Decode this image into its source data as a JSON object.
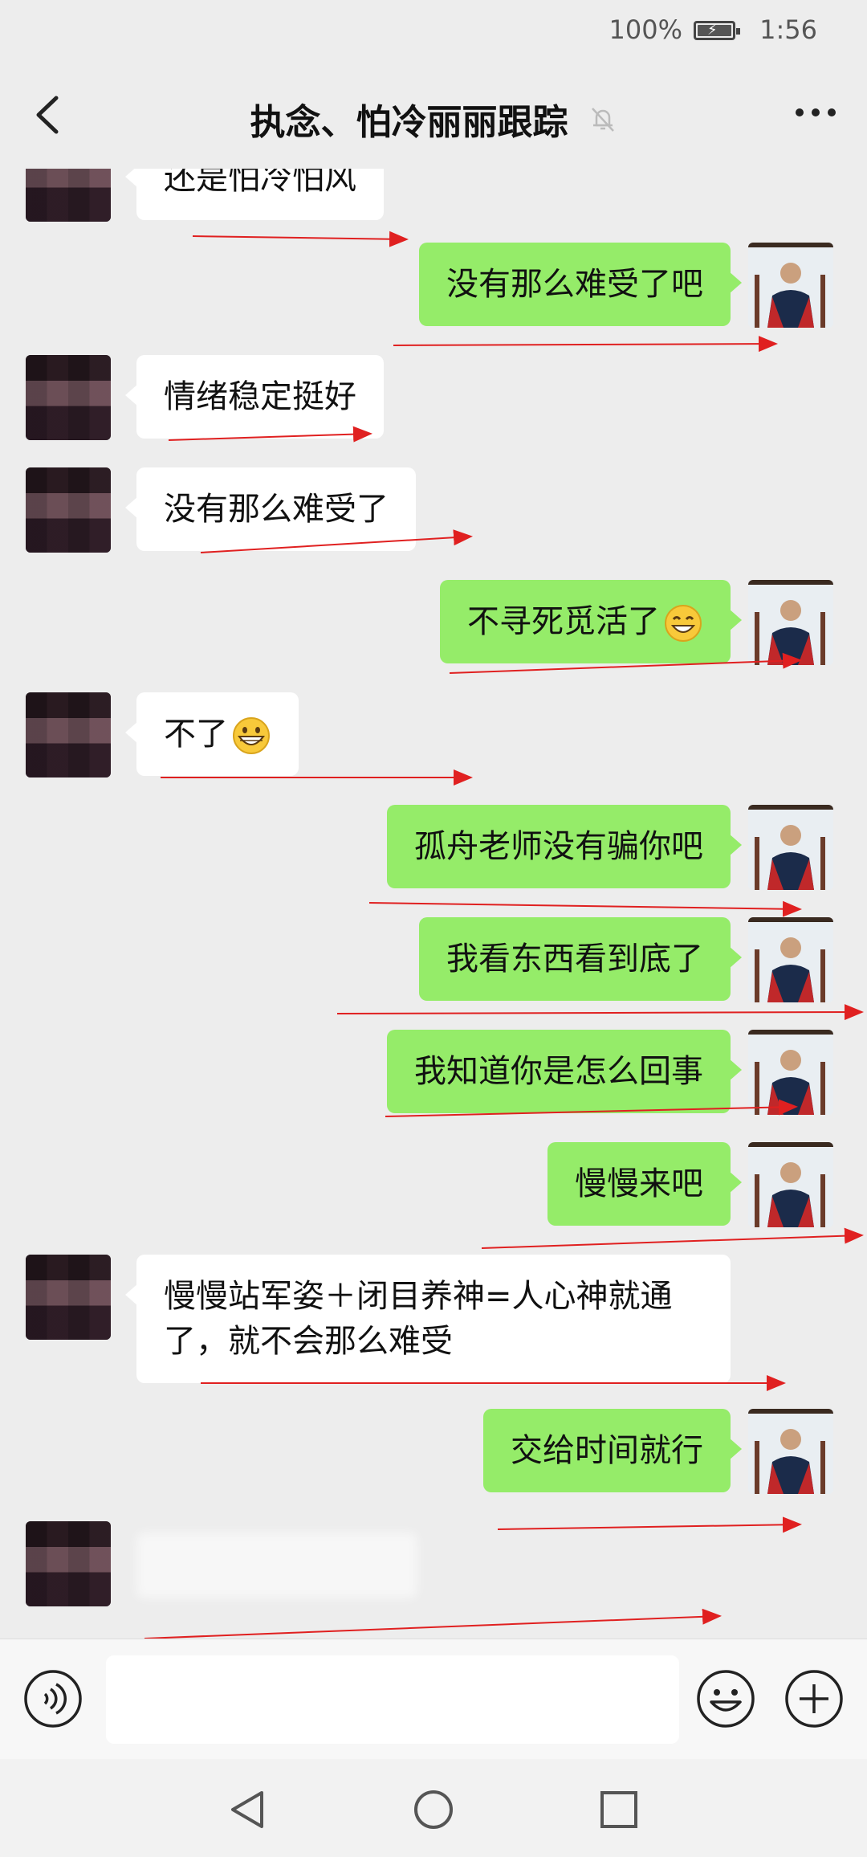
{
  "status_bar": {
    "battery_percent": "100%",
    "time": "1:56"
  },
  "header": {
    "title": "执念、怕冷丽丽跟踪"
  },
  "messages": [
    {
      "side": "left",
      "text": "还是怕冷怕风"
    },
    {
      "side": "right",
      "text": "没有那么难受了吧"
    },
    {
      "side": "left",
      "text": "情绪稳定挺好"
    },
    {
      "side": "left",
      "text": "没有那么难受了"
    },
    {
      "side": "right",
      "text": "不寻死觅活了",
      "emoji": "grin-emoji"
    },
    {
      "side": "left",
      "text": "不了",
      "emoji": "grin-emoji"
    },
    {
      "side": "right",
      "text": "孤舟老师没有骗你吧"
    },
    {
      "side": "right",
      "text": "我看东西看到底了"
    },
    {
      "side": "right",
      "text": "我知道你是怎么回事"
    },
    {
      "side": "right",
      "text": "慢慢来吧"
    },
    {
      "side": "left",
      "text": "慢慢站军姿＋闭目养神=人心神就通了，就不会那么难受"
    },
    {
      "side": "right",
      "text": "交给时间就行"
    }
  ],
  "input_bar": {
    "placeholder": ""
  },
  "icons": {
    "back": "back-arrow-icon",
    "mute": "mute-bell-icon",
    "more": "more-dots-icon",
    "voice": "voice-icon",
    "emoji": "emoji-icon",
    "plus": "plus-icon",
    "nav_back": "nav-back-icon",
    "nav_home": "nav-home-icon",
    "nav_recent": "nav-recent-icon"
  },
  "colors": {
    "sent_bubble": "#95ec69",
    "received_bubble": "#ffffff",
    "background": "#ededed",
    "annotation": "#e02020"
  }
}
